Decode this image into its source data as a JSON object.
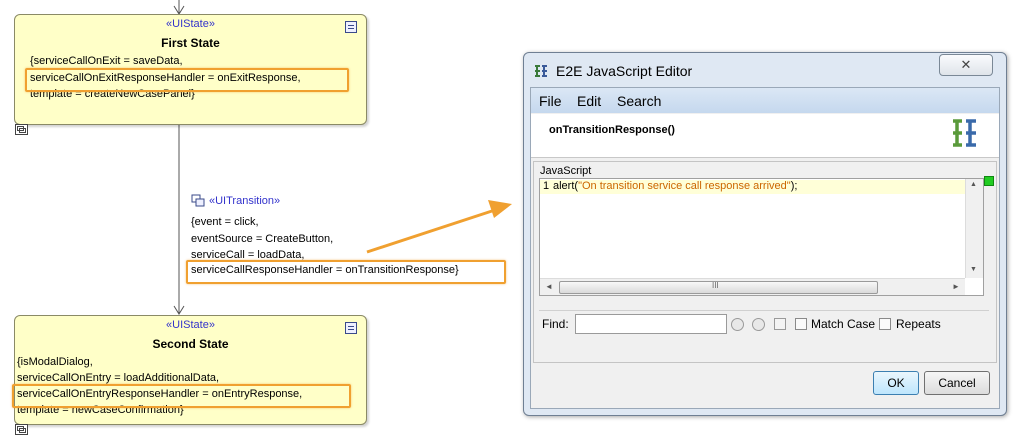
{
  "first_state": {
    "stereotype": "«UIState»",
    "name": "First State",
    "lines": [
      "{serviceCallOnExit = saveData,",
      "serviceCallOnExitResponseHandler = onExitResponse,",
      "template = createNewCasePanel}"
    ]
  },
  "transition": {
    "stereotype": "«UITransition»",
    "lines": [
      "{event = click,",
      "eventSource = CreateButton,",
      "serviceCall = loadData,",
      "serviceCallResponseHandler = onTransitionResponse}"
    ]
  },
  "second_state": {
    "stereotype": "«UIState»",
    "name": "Second State",
    "lines": [
      "{isModalDialog,",
      "serviceCallOnEntry = loadAdditionalData,",
      "serviceCallOnEntryResponseHandler = onEntryResponse,",
      "template = newCaseConfirmation}"
    ]
  },
  "editor": {
    "title": "E2E JavaScript Editor",
    "close_glyph": "✕",
    "menu": [
      "File",
      "Edit",
      "Search"
    ],
    "function_name": "onTransitionResponse()",
    "logo_text": "E2E",
    "group_label": "JavaScript",
    "code_line_number": "1",
    "code": {
      "prefix": "alert(",
      "string": "\"On transition service call response arrived\"",
      "suffix": ");"
    },
    "scroll_up": "▲",
    "scroll_down": "▼",
    "scroll_left": "◄",
    "scroll_right": "►",
    "scroll_grip": "III",
    "find_label": "Find:",
    "find_value": "",
    "match_case_label": "Match Case",
    "repeats_label": "Repeats",
    "ok_label": "OK",
    "cancel_label": "Cancel"
  },
  "colors": {
    "highlight": "#f0a030",
    "stereotype": "#3333cc",
    "string": "#cc6600",
    "state_fill": "#ffffc8"
  }
}
